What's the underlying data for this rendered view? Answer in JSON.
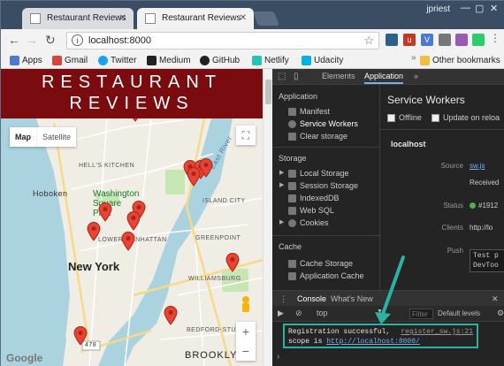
{
  "browser": {
    "tabs": [
      {
        "title": "Restaurant Reviews",
        "active": false
      },
      {
        "title": "Restaurant Reviews",
        "active": true
      }
    ],
    "user": "jpriest",
    "url": "localhost:8000",
    "bookmarks": [
      {
        "label": "Apps",
        "icon": "apps-grid-icon",
        "color": "#4a7bd0"
      },
      {
        "label": "Gmail",
        "icon": "gmail-icon",
        "color": "#d44638"
      },
      {
        "label": "Twitter",
        "icon": "twitter-icon",
        "color": "#1da1f2"
      },
      {
        "label": "Medium",
        "icon": "medium-icon",
        "color": "#222222"
      },
      {
        "label": "GitHub",
        "icon": "github-icon",
        "color": "#222222"
      },
      {
        "label": "Netlify",
        "icon": "netlify-icon",
        "color": "#20c6b7"
      },
      {
        "label": "Udacity",
        "icon": "udacity-icon",
        "color": "#02b3e4"
      }
    ],
    "other_bookmarks": "Other bookmarks"
  },
  "page": {
    "title_line1": "RESTAURANT",
    "title_line2": "REVIEWS",
    "header_color": "#7a0c0f",
    "map": {
      "toggle_map": "Map",
      "toggle_satellite": "Satellite",
      "labels": {
        "hells_kitchen": "HELL'S KITCHEN",
        "washington_square": "Washington Square Park",
        "hoboken": "Hoboken",
        "new_york": "New York",
        "lower_manhattan": "LOWER MANHATTAN",
        "long_island_city": "ISLAND CITY",
        "greenpoint": "GREENPOINT",
        "williamsburg": "WILLIAMSBURG",
        "bedford_stuyvesant": "BEDFORD-STUYVE",
        "brooklyn": "BROOKLYN",
        "east_river": "East River",
        "google": "Google",
        "route": "478"
      },
      "zoom_in": "+",
      "zoom_out": "−"
    }
  },
  "devtools": {
    "tabs": [
      "Elements",
      "Application"
    ],
    "active_tab": "Application",
    "more": "»",
    "sidebar": {
      "application_header": "Application",
      "application_items": [
        "Manifest",
        "Service Workers",
        "Clear storage"
      ],
      "storage_header": "Storage",
      "storage_items": [
        "Local Storage",
        "Session Storage",
        "IndexedDB",
        "Web SQL",
        "Cookies"
      ],
      "cache_header": "Cache",
      "cache_items": [
        "Cache Storage",
        "Application Cache"
      ]
    },
    "service_workers": {
      "title": "Service Workers",
      "offline": "Offline",
      "update_on_reload": "Update on reloa",
      "origin": "localhost",
      "source_label": "Source",
      "source_value": "sw.js",
      "received_value": "Received",
      "status_label": "Status",
      "status_value": "#1912",
      "clients_label": "Clients",
      "clients_value": "http://lo",
      "push_label": "Push",
      "push_line1": "Test p",
      "push_line2": "DevToo"
    },
    "drawer": {
      "tabs": [
        "Console",
        "What's New"
      ],
      "context": "top",
      "filter_placeholder": "Filter",
      "levels": "Default levels"
    },
    "console": {
      "line1": "Registration successful,",
      "source": "register_sw.js:21",
      "line2_prefix": "scope is ",
      "line2_link": "http://localhost:8000/"
    }
  }
}
